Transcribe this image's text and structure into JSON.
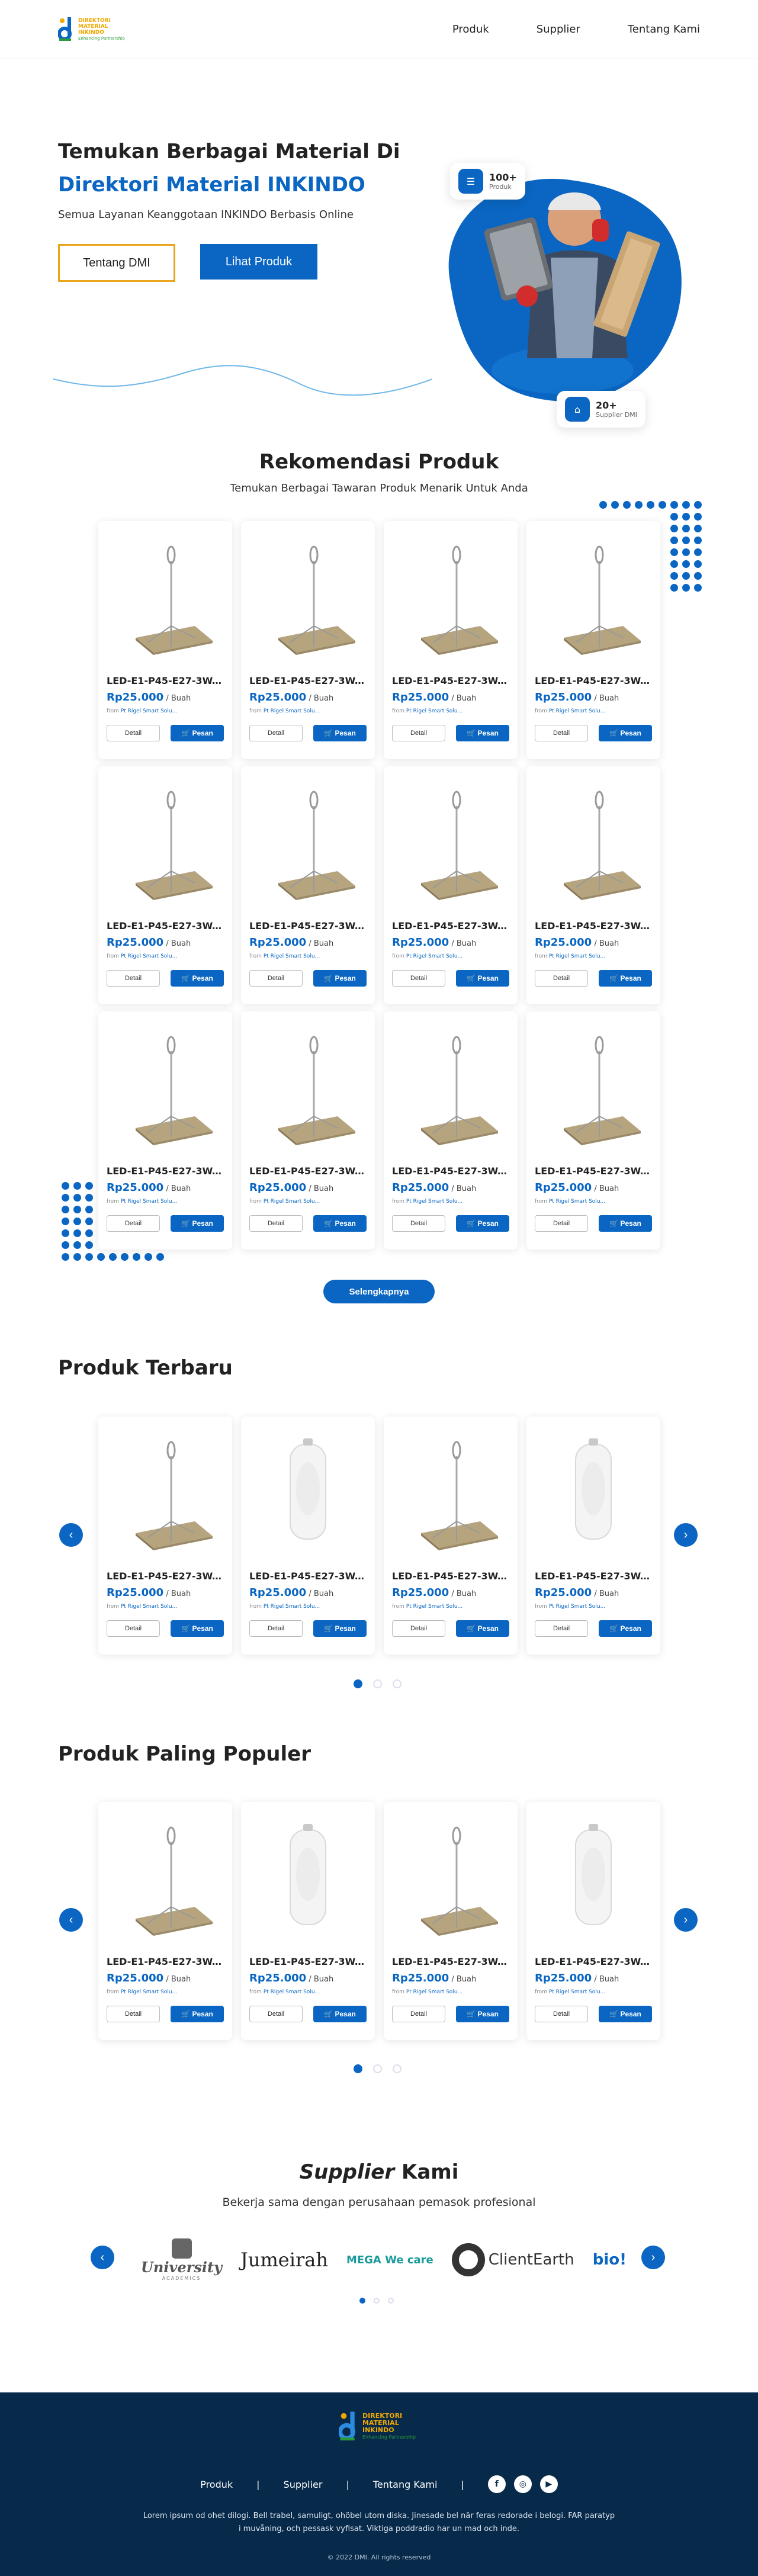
{
  "brand": {
    "logo_line1": "DIREKTORI",
    "logo_line2": "MATERIAL",
    "logo_line3": "INKINDO",
    "logo_tagline": "Enhancing Partnership"
  },
  "nav": {
    "items": [
      "Produk",
      "Supplier",
      "Tentang Kami"
    ]
  },
  "hero": {
    "title_line1": "Temukan Berbagai Material Di",
    "title_line2": "Direktori Material INKINDO",
    "subtitle": "Semua Layanan Keanggotaan INKINDO Berbasis Online",
    "btn_dmi": "Tentang DMI",
    "btn_products": "Lihat Produk",
    "stat1_num": "100+",
    "stat1_label": "Produk",
    "stat2_num": "20+",
    "stat2_label": "Supplier DMI"
  },
  "recommended": {
    "title": "Rekomendasi Produk",
    "subtitle": "Temukan Berbagai Tawaran Produk Menarik Untuk Anda",
    "more": "Selengkapnya"
  },
  "product": {
    "name": "LED-E1-P45-E27-3W.....",
    "price": "Rp25.000",
    "unit": "/ Buah",
    "from_label": "from",
    "supplier": "Pt Rigel Smart Solu...",
    "detail": "Detail",
    "order": "Pesan"
  },
  "latest": {
    "title": "Produk Terbaru"
  },
  "popular": {
    "title": "Produk Paling Populer"
  },
  "supplier": {
    "title_em": "Supplier",
    "title_rest": "Kami",
    "subtitle": "Bekerja sama dengan perusahaan pemasok profesional",
    "logos": [
      "University",
      "Jumeirah",
      "MEGA We care",
      "ClientEarth",
      "bio!"
    ],
    "university_sub": "ACADEMICS"
  },
  "footer": {
    "nav": [
      "Produk",
      "Supplier",
      "Tentang Kami"
    ],
    "separator": "|",
    "desc": "Lorem ipsum od ohet dilogi. Bell trabel, samuligt, ohöbel utom diska. Jinesade bel när feras redorade i belogi. FAR paratyp i muvåning, och pessask vyfisat. Viktiga poddradio har un mad och inde.",
    "copyright": "© 2022 DMI. All rights reserved"
  },
  "colors": {
    "primary": "#0a66c2",
    "accent": "#e8a51d",
    "footer_bg": "#07294a"
  }
}
